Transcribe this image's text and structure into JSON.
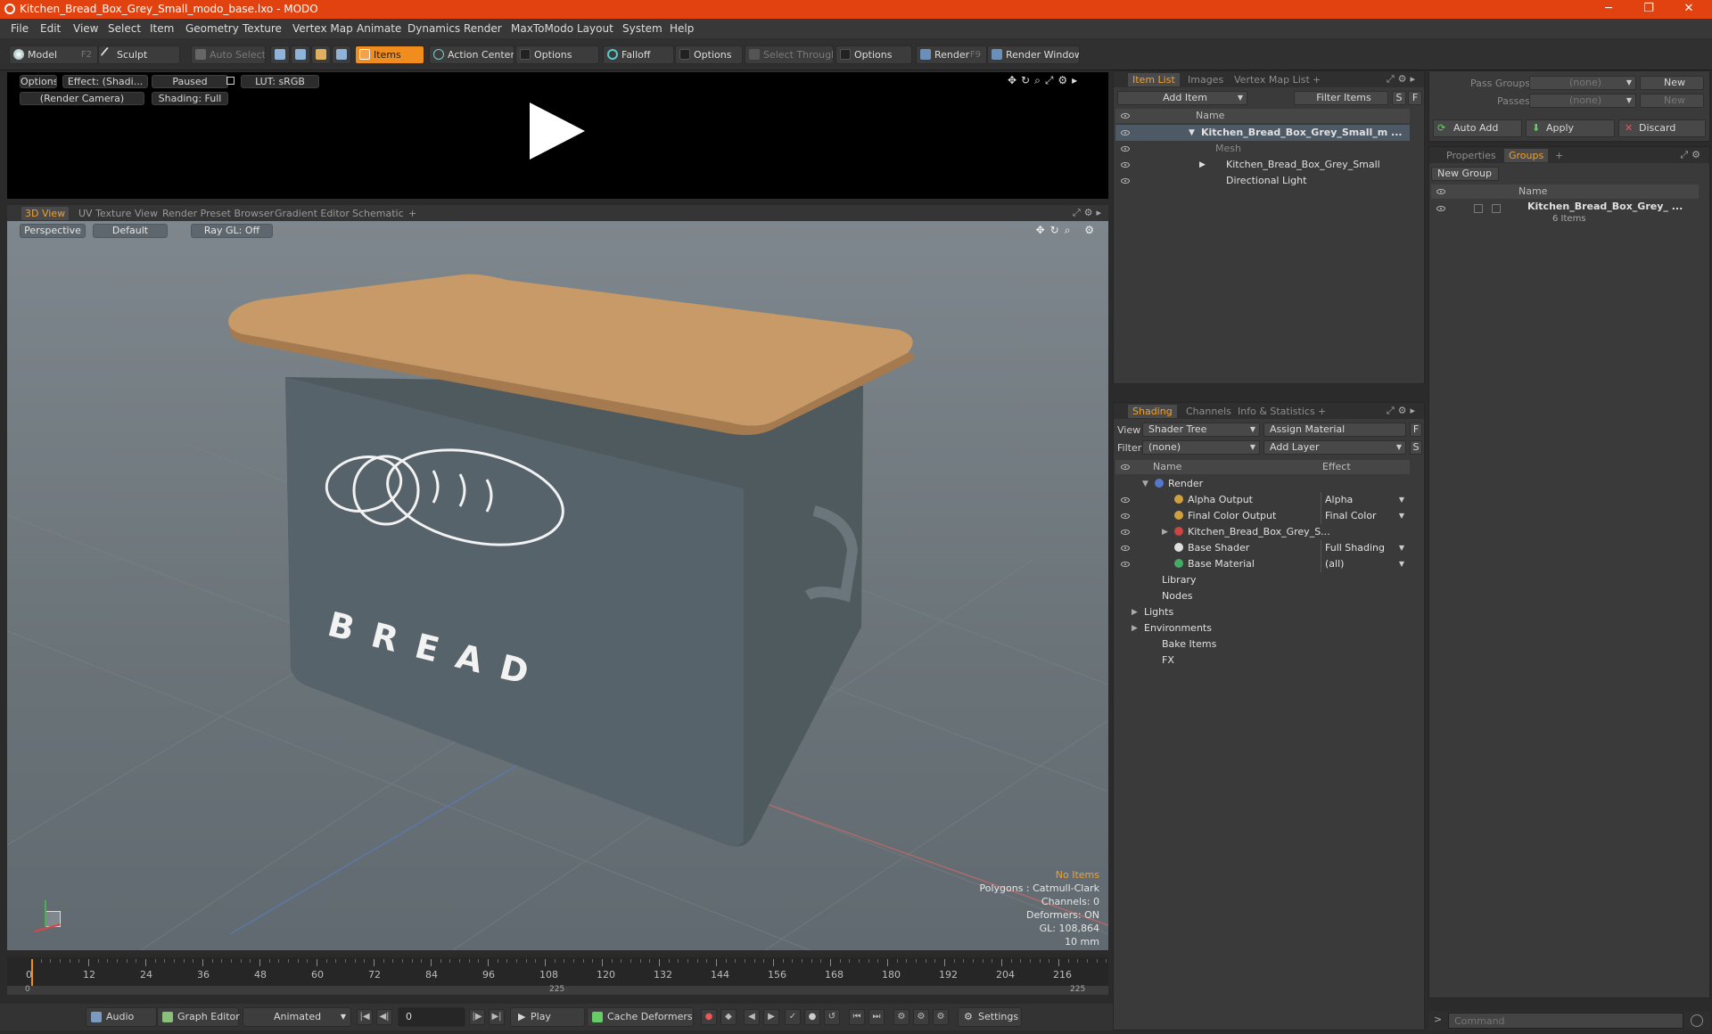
{
  "window": {
    "title": "Kitchen_Bread_Box_Grey_Small_modo_base.lxo - MODO",
    "minimize": "─",
    "maximize": "❐",
    "close": "✕"
  },
  "menu": [
    "File",
    "Edit",
    "View",
    "Select",
    "Item",
    "Geometry",
    "Texture",
    "Vertex Map",
    "Animate",
    "Dynamics",
    "Render",
    "MaxToModo",
    "Layout",
    "System",
    "Help"
  ],
  "toolbar": {
    "model": "Model",
    "model_key": "F2",
    "sculpt": "Sculpt",
    "auto_select": "Auto Select",
    "items": "Items",
    "action_center": "Action Center",
    "options1": "Options",
    "falloff": "Falloff",
    "options2": "Options",
    "select_through": "Select Through",
    "options3": "Options",
    "render": "Render",
    "render_key": "F9",
    "render_window": "Render Window"
  },
  "preview": {
    "options": "Options",
    "effect": "Effect: (Shadi...",
    "paused": "Paused",
    "lut": "LUT: sRGB",
    "camera": "(Render Camera)",
    "shading": "Shading: Full"
  },
  "viewport_tabs": [
    "3D View",
    "UV Texture View",
    "Render Preset Browser",
    "Gradient Editor",
    "Schematic",
    "+"
  ],
  "viewport": {
    "perspective": "Perspective",
    "default": "Default",
    "raygl": "Ray GL: Off",
    "stats": [
      "No Items",
      "Polygons : Catmull-Clark",
      "Channels: 0",
      "Deformers: ON",
      "GL: 108,864",
      "10 mm"
    ],
    "bread_text": "B R E A D"
  },
  "timeline": {
    "ticks": [
      "0",
      "12",
      "24",
      "36",
      "48",
      "60",
      "72",
      "84",
      "96",
      "108",
      "120",
      "132",
      "144",
      "156",
      "168",
      "180",
      "192",
      "204",
      "216"
    ],
    "sub_left": "0",
    "sub_mid": "225",
    "sub_right": "225"
  },
  "bottom": {
    "audio": "Audio",
    "graph_editor": "Graph Editor",
    "animated": "Animated",
    "frame": "0",
    "play": "Play",
    "cache": "Cache Deformers",
    "settings": "Settings"
  },
  "item_list": {
    "tabs": [
      "Item List",
      "Images",
      "Vertex Map List",
      "+"
    ],
    "add_item": "Add Item",
    "filter": "Filter Items",
    "s": "S",
    "f": "F",
    "col_name": "Name",
    "rows": [
      "Kitchen_Bread_Box_Grey_Small_m ...",
      "Mesh",
      "Kitchen_Bread_Box_Grey_Small",
      "Directional Light"
    ]
  },
  "shading": {
    "tabs": [
      "Shading",
      "Channels",
      "Info & Statistics",
      "+"
    ],
    "view_label": "View",
    "view_value": "Shader Tree",
    "assign": "Assign Material",
    "f": "F",
    "filter_label": "Filter",
    "filter_value": "(none)",
    "add_layer": "Add Layer",
    "s": "S",
    "col_name": "Name",
    "col_effect": "Effect",
    "rows": [
      {
        "name": "Render",
        "effect": ""
      },
      {
        "name": "Alpha Output",
        "effect": "Alpha"
      },
      {
        "name": "Final Color Output",
        "effect": "Final Color"
      },
      {
        "name": "Kitchen_Bread_Box_Grey_S...",
        "effect": ""
      },
      {
        "name": "Base Shader",
        "effect": "Full Shading"
      },
      {
        "name": "Base Material",
        "effect": "(all)"
      },
      {
        "name": "Library",
        "effect": ""
      },
      {
        "name": "Nodes",
        "effect": ""
      },
      {
        "name": "Lights",
        "effect": ""
      },
      {
        "name": "Environments",
        "effect": ""
      },
      {
        "name": "Bake Items",
        "effect": ""
      },
      {
        "name": "FX",
        "effect": ""
      }
    ]
  },
  "passes": {
    "pass_groups": "Pass Groups",
    "passes": "Passes",
    "none1": "(none)",
    "none2": "(none)",
    "new1": "New",
    "new2": "New",
    "auto_add": "Auto Add",
    "apply": "Apply",
    "discard": "Discard"
  },
  "groups": {
    "tabs": [
      "Properties",
      "Groups",
      "+"
    ],
    "new_group": "New Group",
    "col_name": "Name",
    "item": "Kitchen_Bread_Box_Grey_ ...",
    "count": "6 Items"
  },
  "command": {
    "placeholder": "Command"
  },
  "colors": {
    "accent": "#f08d1e",
    "title_bar": "#e2420f",
    "lid": "#c79a68",
    "box": "#4f5a5f"
  }
}
